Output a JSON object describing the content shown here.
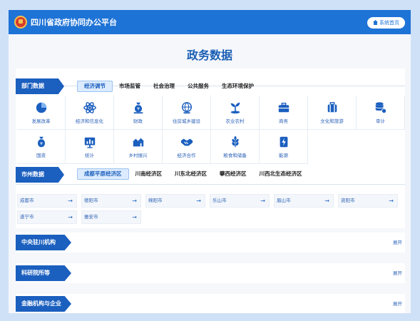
{
  "header": {
    "title": "四川省政府协同办公平台",
    "home_label": "系统首页"
  },
  "page_title": "政务数据",
  "dept_section": {
    "label": "部门数据",
    "tabs": [
      "经济调节",
      "市场监管",
      "社会治理",
      "公共服务",
      "生态环境保护"
    ],
    "items": [
      {
        "label": "发展改革",
        "icon": "pie-chart-icon"
      },
      {
        "label": "经济和信息化",
        "icon": "atom-icon"
      },
      {
        "label": "财政",
        "icon": "money-bag-icon"
      },
      {
        "label": "住房城乡建设",
        "icon": "globe-icon"
      },
      {
        "label": "农业农村",
        "icon": "sprout-icon"
      },
      {
        "label": "商务",
        "icon": "briefcase-icon"
      },
      {
        "label": "文化和旅游",
        "icon": "suitcase-icon"
      },
      {
        "label": "审计",
        "icon": "database-icon"
      },
      {
        "label": "国资",
        "icon": "yuan-bag-icon"
      },
      {
        "label": "统计",
        "icon": "bar-chart-icon"
      },
      {
        "label": "乡村振兴",
        "icon": "village-icon"
      },
      {
        "label": "经济合作",
        "icon": "handshake-icon"
      },
      {
        "label": "粮食和储备",
        "icon": "grain-icon"
      },
      {
        "label": "能源",
        "icon": "energy-icon"
      }
    ]
  },
  "city_section": {
    "label": "市州数据",
    "tabs": [
      "成都平原经济区",
      "川南经济区",
      "川东北经济区",
      "攀西经济区",
      "川西北生态经济区"
    ],
    "cities": [
      "成都市",
      "德阳市",
      "绵阳市",
      "乐山市",
      "眉山市",
      "资阳市",
      "遂宁市",
      "雅安市"
    ]
  },
  "collapsed_sections": [
    {
      "label": "中央驻川机构",
      "action": "展开"
    },
    {
      "label": "科研院所等",
      "action": "展开"
    },
    {
      "label": "金融机构与企业",
      "action": "展开"
    }
  ],
  "colors": {
    "primary": "#1e73d6",
    "label_bg": "#1b5fbf",
    "text_blue": "#2c62b8"
  }
}
